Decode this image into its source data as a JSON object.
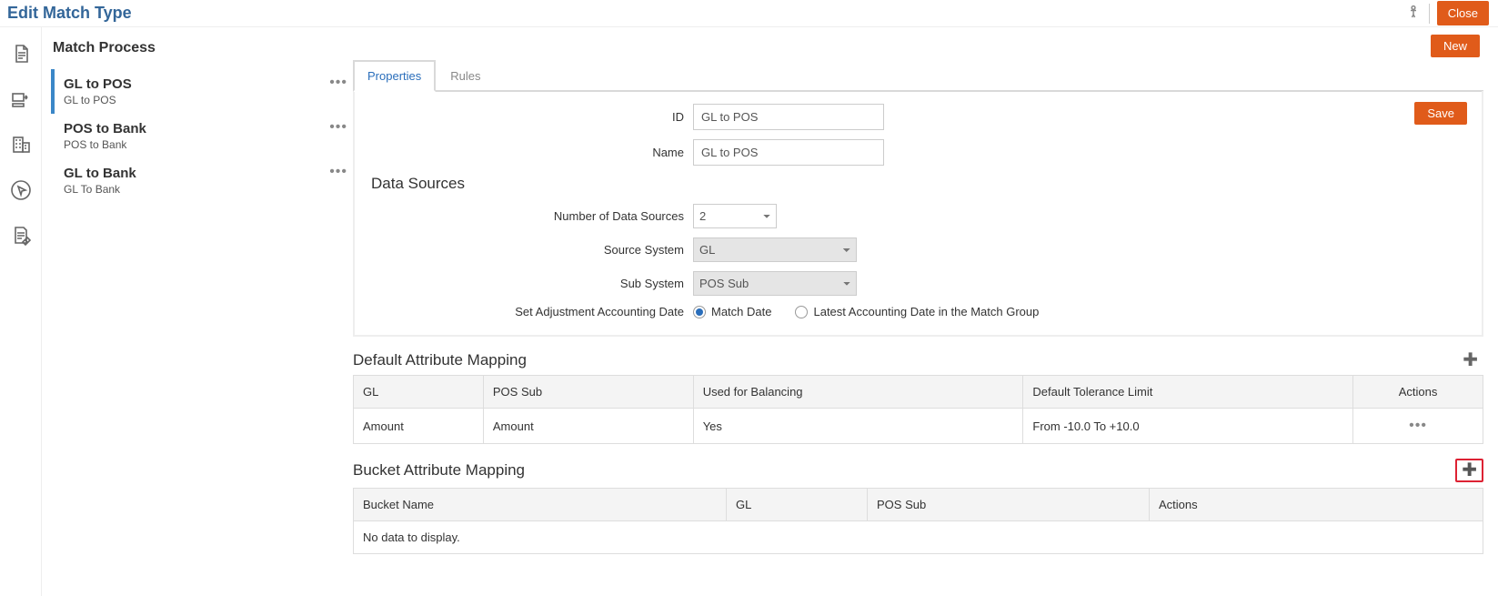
{
  "topbar": {
    "title": "Edit Match Type",
    "close_label": "Close"
  },
  "sidebar": {
    "title": "Match Process",
    "items": [
      {
        "title": "GL to POS",
        "sub": "GL to POS"
      },
      {
        "title": "POS to Bank",
        "sub": "POS to Bank"
      },
      {
        "title": "GL to Bank",
        "sub": "GL To Bank"
      }
    ]
  },
  "main": {
    "new_label": "New",
    "tabs": {
      "properties": "Properties",
      "rules": "Rules"
    },
    "save_label": "Save",
    "form": {
      "id_label": "ID",
      "id_value": "GL to POS",
      "name_label": "Name",
      "name_value": "GL to POS"
    },
    "data_sources": {
      "heading": "Data Sources",
      "count_label": "Number of Data Sources",
      "count_value": "2",
      "source_label": "Source System",
      "source_value": "GL",
      "sub_label": "Sub System",
      "sub_value": "POS Sub",
      "adj_label": "Set Adjustment Accounting Date",
      "adj_opt1": "Match Date",
      "adj_opt2": "Latest Accounting Date in the Match Group"
    },
    "default_mapping": {
      "title": "Default Attribute Mapping",
      "headers": {
        "c1": "GL",
        "c2": "POS Sub",
        "c3": "Used for Balancing",
        "c4": "Default Tolerance Limit",
        "c5": "Actions"
      },
      "row": {
        "c1": "Amount",
        "c2": "Amount",
        "c3": "Yes",
        "c4": "From -10.0 To +10.0"
      }
    },
    "bucket_mapping": {
      "title": "Bucket Attribute Mapping",
      "headers": {
        "c1": "Bucket Name",
        "c2": "GL",
        "c3": "POS Sub",
        "c4": "Actions"
      },
      "empty": "No data to display."
    }
  }
}
